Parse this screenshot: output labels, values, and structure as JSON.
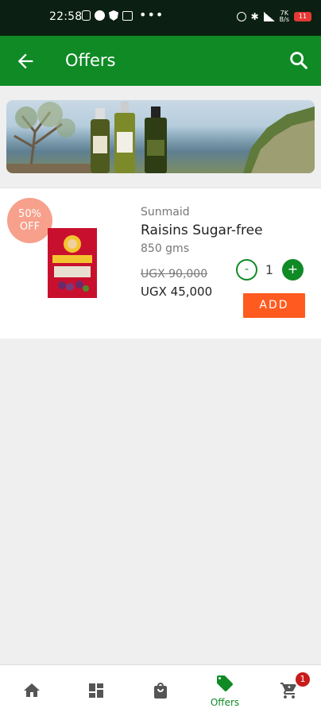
{
  "status_bar": {
    "time": "22:58",
    "dots": "•••",
    "net_speed_top": "7K",
    "net_speed_bottom": "B/s",
    "battery": "11"
  },
  "app_bar": {
    "title": "Offers"
  },
  "product": {
    "discount_line1": "50%",
    "discount_line2": "OFF",
    "brand": "Sunmaid",
    "name": "Raisins Sugar-free",
    "weight": "850 gms",
    "old_price": "UGX 90,000",
    "new_price": "UGX 45,000",
    "qty_minus": "-",
    "quantity": "1",
    "qty_plus": "+",
    "add_label": "ADD"
  },
  "bottom_nav": {
    "offers_label": "Offers",
    "cart_badge": "1"
  },
  "colors": {
    "primary_green": "#0f8a25",
    "add_orange": "#ff5a1f",
    "discount_badge": "#f7a08c",
    "cart_badge": "#c81b1b"
  }
}
